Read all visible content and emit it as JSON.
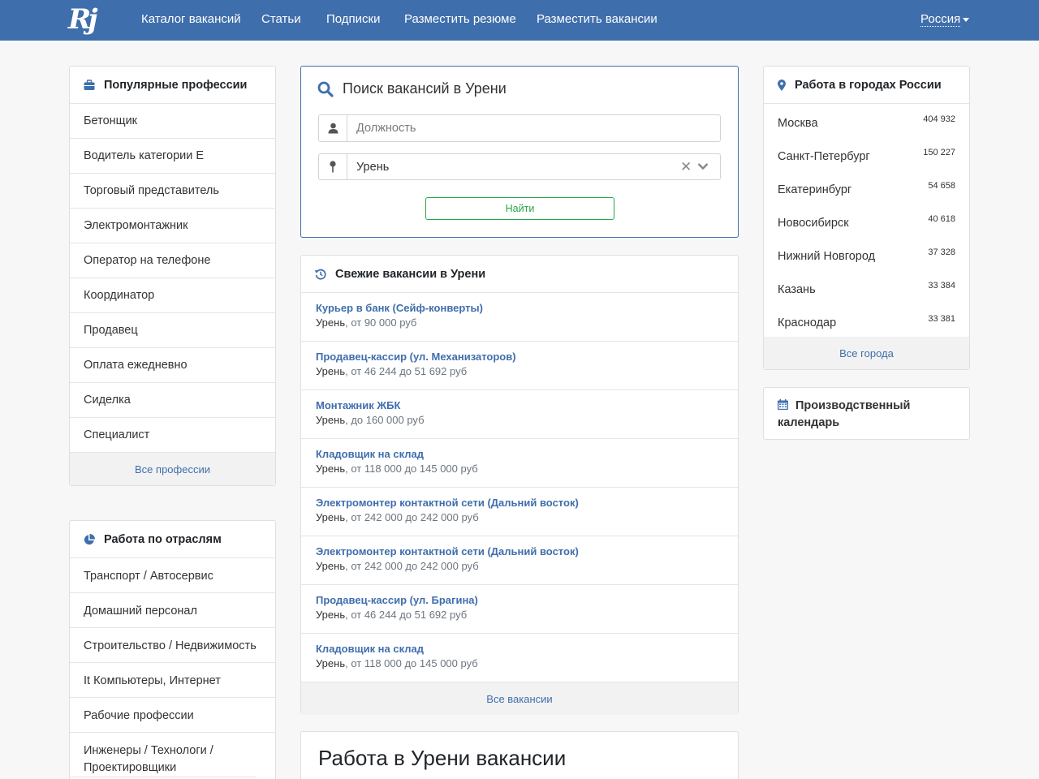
{
  "nav": {
    "logo": "Rj",
    "items": [
      "Каталог вакансий",
      "Статьи",
      "Подписки",
      "Разместить резюме",
      "Разместить вакансии"
    ],
    "country": "Россия"
  },
  "professions": {
    "title": "Популярные профессии",
    "items": [
      "Бетонщик",
      "Водитель категории Е",
      "Торговый представитель",
      "Электромонтажник",
      "Оператор на телефоне",
      "Координатор",
      "Продавец",
      "Оплата ежедневно",
      "Сиделка",
      "Специалист"
    ],
    "footer": "Все профессии"
  },
  "industries": {
    "title": "Работа по отраслям",
    "items": [
      "Транспорт / Автосервис",
      "Домашний персонал",
      "Строительство / Недвижимость",
      "It Компьютеры, Интернет",
      "Рабочие профессии",
      "Инженеры / Технологи / Проектировщики"
    ]
  },
  "search": {
    "title": "Поиск вакансий в Урени",
    "position_placeholder": "Должность",
    "city_value": "Урень",
    "button": "Найти"
  },
  "fresh": {
    "title": "Свежие вакансии в Урени",
    "jobs": [
      {
        "title": "Курьер в банк (Сейф-конверты)",
        "city": "Урень",
        "salary": ", от 90 000 руб"
      },
      {
        "title": "Продавец-кассир (ул. Механизаторов)",
        "city": "Урень",
        "salary": ", от 46 244 до 51 692 руб"
      },
      {
        "title": "Монтажник ЖБК",
        "city": "Урень",
        "salary": ", до 160 000 руб"
      },
      {
        "title": "Кладовщик на склад",
        "city": "Урень",
        "salary": ", от 118 000 до 145 000 руб"
      },
      {
        "title": "Электромонтер контактной сети (Дальний восток)",
        "city": "Урень",
        "salary": ", от 242 000 до 242 000 руб"
      },
      {
        "title": "Электромонтер контактной сети (Дальний восток)",
        "city": "Урень",
        "salary": ", от 242 000 до 242 000 руб"
      },
      {
        "title": "Продавец-кассир (ул. Брагина)",
        "city": "Урень",
        "salary": ", от 46 244 до 51 692 руб"
      },
      {
        "title": "Кладовщик на склад",
        "city": "Урень",
        "salary": ", от 118 000 до 145 000 руб"
      }
    ],
    "footer": "Все вакансии"
  },
  "work_title": "Работа в Урени вакансии",
  "cities": {
    "title": "Работа в городах России",
    "items": [
      {
        "name": "Москва",
        "count": "404 932"
      },
      {
        "name": "Санкт-Петербург",
        "count": "150 227"
      },
      {
        "name": "Екатеринбург",
        "count": "54 658"
      },
      {
        "name": "Новосибирск",
        "count": "40 618"
      },
      {
        "name": "Нижний Новгород",
        "count": "37 328"
      },
      {
        "name": "Казань",
        "count": "33 384"
      },
      {
        "name": "Краснодар",
        "count": "33 381"
      }
    ],
    "footer": "Все города"
  },
  "calendar": {
    "title": "Производственный календарь"
  },
  "colors": {
    "brand": "#3f6eac",
    "button": "#28a745"
  }
}
